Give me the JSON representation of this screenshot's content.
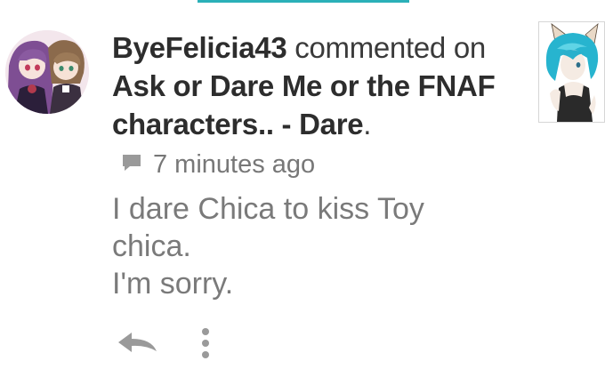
{
  "comment": {
    "author": "ByeFelicia43",
    "verb": "commented on",
    "post_title_line1": "Ask or Dare Me or the FNAF",
    "post_title_line2": "characters.. - Dare",
    "post_title_end": ".",
    "timestamp": "7 minutes ago",
    "body_lines": [
      "I dare Chica to kiss Toy",
      "chica.",
      "I'm sorry."
    ]
  },
  "icons": {
    "meta": "comment-bubble-icon",
    "reply": "reply-arrow-icon",
    "more": "more-vertical-icon"
  },
  "colors": {
    "accent": "#2bb0b8",
    "title_text": "#2d2d2d",
    "body_text": "#7a7a7a",
    "icon": "#9a9a9a"
  }
}
